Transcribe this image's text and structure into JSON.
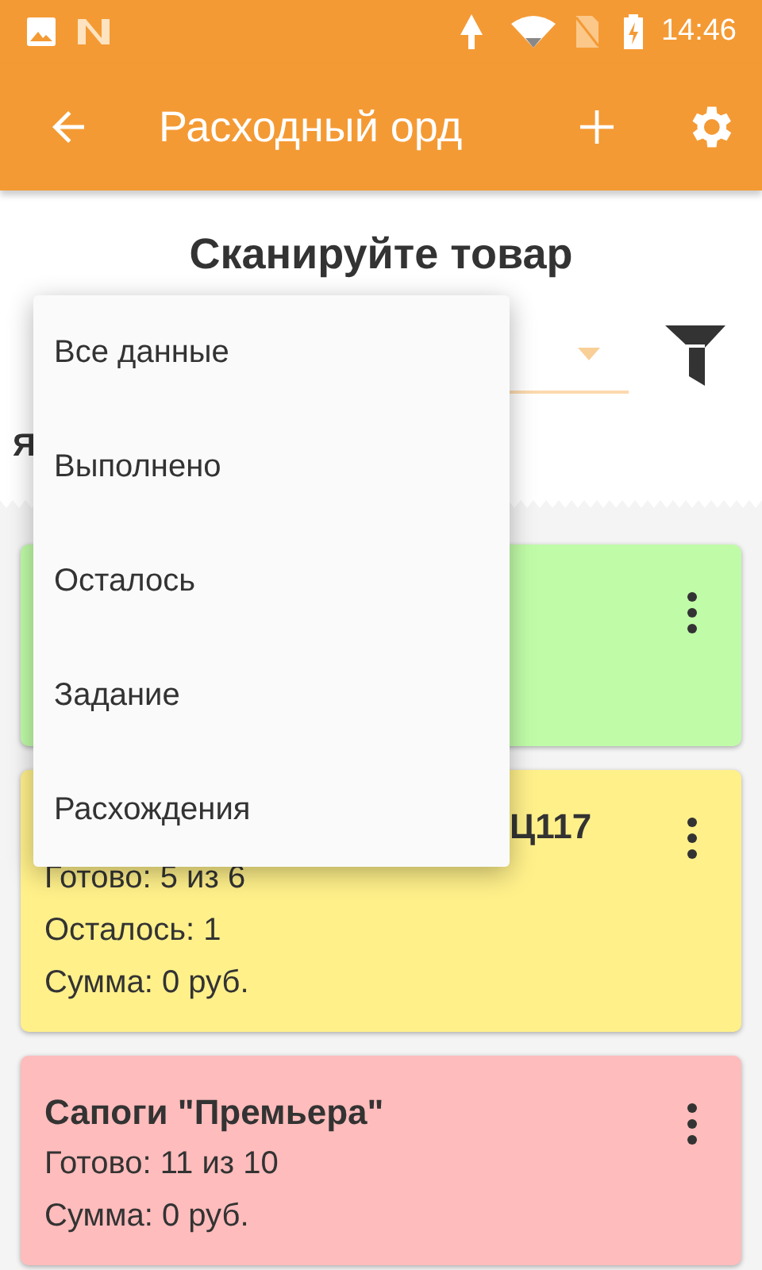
{
  "status_bar": {
    "time": "14:46"
  },
  "app_bar": {
    "title": "Расходный орд"
  },
  "header": {
    "title": "Сканируйте товар",
    "label": "Я"
  },
  "cards": [
    {
      "color": "#c0fca8"
    },
    {
      "color": "#fff08a",
      "title": "Ц117",
      "lines": [
        "Готово: 5 из 6",
        "Осталось: 1",
        "Сумма: 0 руб."
      ]
    },
    {
      "color": "#ffbcbc",
      "title": "Сапоги \"Премьера\"",
      "lines": [
        "Готово: 11 из 10",
        "Сумма: 0 руб."
      ]
    }
  ],
  "menu": {
    "items": [
      "Все данные",
      "Выполнено",
      "Осталось",
      "Задание",
      "Расхождения"
    ]
  }
}
